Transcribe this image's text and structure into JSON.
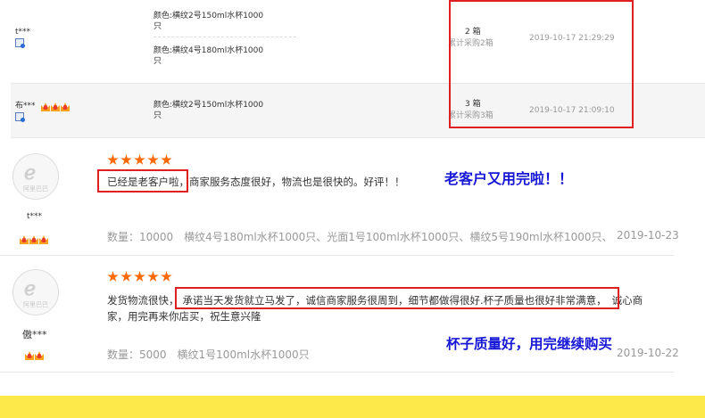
{
  "top_rows": [
    {
      "user": "t***",
      "specs": [
        "颜色:横纹2号150ml水杯1000",
        "只",
        "颜色:横纹4号180ml水杯1000",
        "只"
      ],
      "qty": "2 箱",
      "cumulative": "累计采购2箱",
      "time": "2019-10-17 21:29:29"
    },
    {
      "user": "布***",
      "specs": [
        "颜色:横纹2号150ml水杯1000",
        "只"
      ],
      "qty": "3 箱",
      "cumulative": "累计采购3箱",
      "time": "2019-10-17 21:09:10"
    }
  ],
  "reviews": [
    {
      "avatar_brand": "阿里巴巴",
      "user": "t***",
      "highlight": "已经是老客户啦",
      "rest": "，商家服务态度很好，物流也是很快的。好评！！",
      "annotation": "老客户又用完啦！！",
      "meta": "数量：10000　横纹4号180ml水杯1000只、光面1号100ml水杯1000只、横纹5号190ml水杯1000只、横纹...",
      "date": "2019-10-23"
    },
    {
      "avatar_brand": "阿里巴巴",
      "user": "傲***",
      "pre": "发货物流很快，",
      "highlight": "承诺当天发货就立马发了，诚信商家服务很周到，细节都做得很好.杯子质量也很好非常满意，",
      "post": "诚心商",
      "line2": "家，用完再来你店买，祝生意兴隆",
      "annotation": "杯子质量好，用完继续购买",
      "meta": "数量：5000　横纹1号100ml水杯1000只",
      "date": "2019-10-22"
    }
  ],
  "colors": {
    "accent": "#ff6a00",
    "highlight_border": "#e02020",
    "annotation": "#1717d6",
    "footer": "#fde94a"
  }
}
